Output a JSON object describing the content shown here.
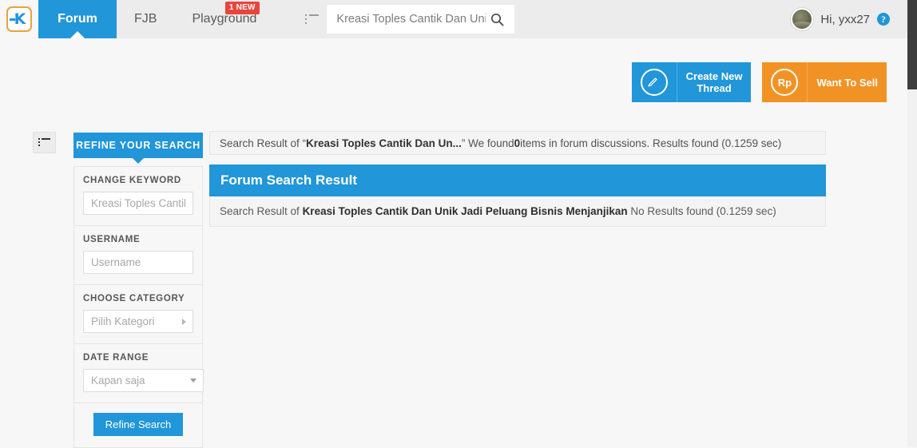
{
  "header": {
    "logo_alt": "kaskus-logo",
    "nav": [
      {
        "label": "Forum",
        "active": true,
        "badge": null
      },
      {
        "label": "FJB",
        "active": false,
        "badge": null
      },
      {
        "label": "Playground",
        "active": false,
        "badge": "1 NEW"
      }
    ],
    "list_icon": "list-icon",
    "search": {
      "value": "Kreasi Toples Cantik Dan Unik",
      "placeholder": "Kreasi Toples Cantik Dan Unik",
      "icon": "search-icon"
    },
    "user": {
      "greeting": "Hi, yxx27",
      "avatar": "user-avatar",
      "help_icon": "?"
    }
  },
  "actions": [
    {
      "icon": "pencil-icon",
      "label": "Create New\nThread",
      "color": "#2196d8"
    },
    {
      "icon": "rupiah-icon",
      "icon_text": "Rp",
      "label": "Want To Sell",
      "color": "#f19324"
    }
  ],
  "sidebar": {
    "toggle_icon": "list-toggle-icon",
    "tab_label": "REFINE YOUR SEARCH",
    "fields": [
      {
        "label": "CHANGE KEYWORD",
        "type": "text",
        "value": "",
        "placeholder": "Kreasi Toples Cantik"
      },
      {
        "label": "USERNAME",
        "type": "text",
        "value": "",
        "placeholder": "Username"
      },
      {
        "label": "CHOOSE CATEGORY",
        "type": "select",
        "value": "Pilih Kategori"
      },
      {
        "label": "DATE RANGE",
        "type": "select",
        "value": "Kapan saja"
      }
    ],
    "submit_label": "Refine Search"
  },
  "main": {
    "result_bar": {
      "prefix": "Search Result of “",
      "query_short": "Kreasi Toples Cantik Dan Un...",
      "middle": "” We found ",
      "count": "0",
      "suffix": " items in forum discussions. Results found (0.1259 sec)"
    },
    "panel_title": "Forum Search Result",
    "panel_body": {
      "prefix": "Search Result of ",
      "query_full": "Kreasi Toples Cantik Dan Unik Jadi Peluang Bisnis Menjanjikan",
      "suffix": " No Results found (0.1259 sec)"
    }
  },
  "colors": {
    "accent_blue": "#2196d8",
    "accent_orange": "#f19324",
    "badge_red": "#e8453c",
    "page_bg": "#f7f7f7"
  }
}
